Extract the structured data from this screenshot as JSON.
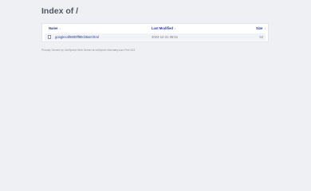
{
  "page": {
    "title": "Index of /"
  },
  "table": {
    "headers": {
      "name": "Name",
      "modified": "Last Modified",
      "size": "Size"
    },
    "sort_icons": {
      "name": "↓",
      "modified": "↕",
      "size": "↕"
    },
    "rows": [
      {
        "name": "googlec4f8800ff80cb5a0.html",
        "modified": "2024-12-31 06:51",
        "size": "53"
      }
    ]
  },
  "footer": {
    "text": "Proudly Served by LiteSpeed Web Server at verifycert.informary.com Port 443"
  }
}
